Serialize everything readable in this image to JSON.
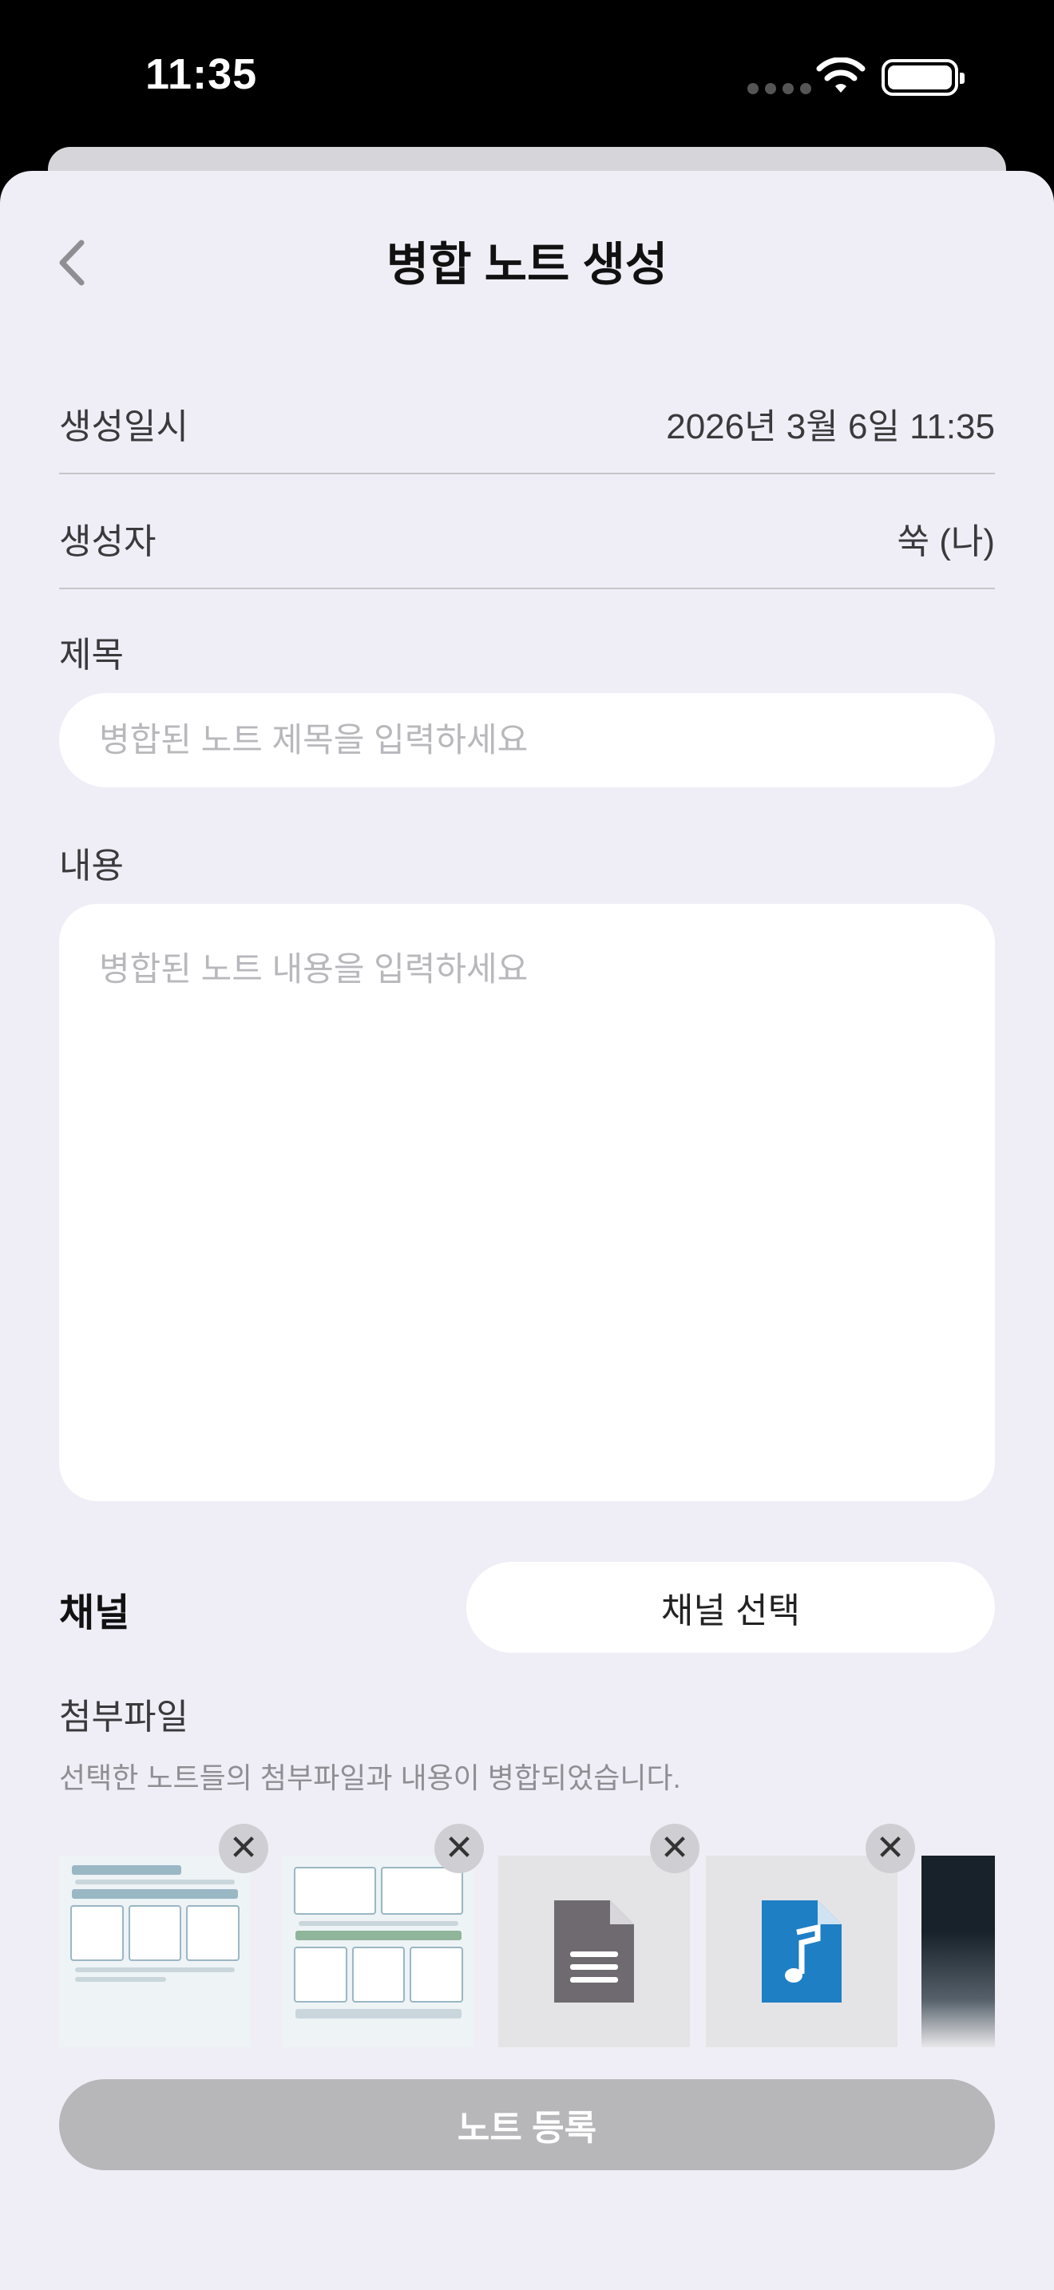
{
  "status_bar": {
    "time": "11:35"
  },
  "nav": {
    "title": "병합 노트 생성"
  },
  "info": {
    "created_at_label": "생성일시",
    "created_at_value": "2026년 3월 6일 11:35",
    "creator_label": "생성자",
    "creator_value": "쑥 (나)"
  },
  "form": {
    "title_label": "제목",
    "title_placeholder": "병합된 노트 제목을 입력하세요",
    "content_label": "내용",
    "content_placeholder": "병합된 노트 내용을 입력하세요",
    "channel_label": "채널",
    "channel_button": "채널 선택",
    "attachments_label": "첨부파일",
    "attachments_desc": "선택한 노트들의 첨부파일과 내용이 병합되었습니다."
  },
  "attachments": [
    {
      "type": "image",
      "icon": "infographic-thumbnail"
    },
    {
      "type": "image",
      "icon": "infographic-thumbnail"
    },
    {
      "type": "document",
      "icon": "document-icon"
    },
    {
      "type": "audio",
      "icon": "music-file-icon"
    },
    {
      "type": "image",
      "icon": "photo-thumbnail"
    }
  ],
  "remove_glyph": "✕",
  "submit_button": "노트 등록",
  "colors": {
    "background": "#efeef6",
    "card": "#ffffff",
    "disabled_button": "#b7b7b9",
    "doc_icon": "#6f6a70",
    "audio_icon": "#1f7fc4"
  }
}
